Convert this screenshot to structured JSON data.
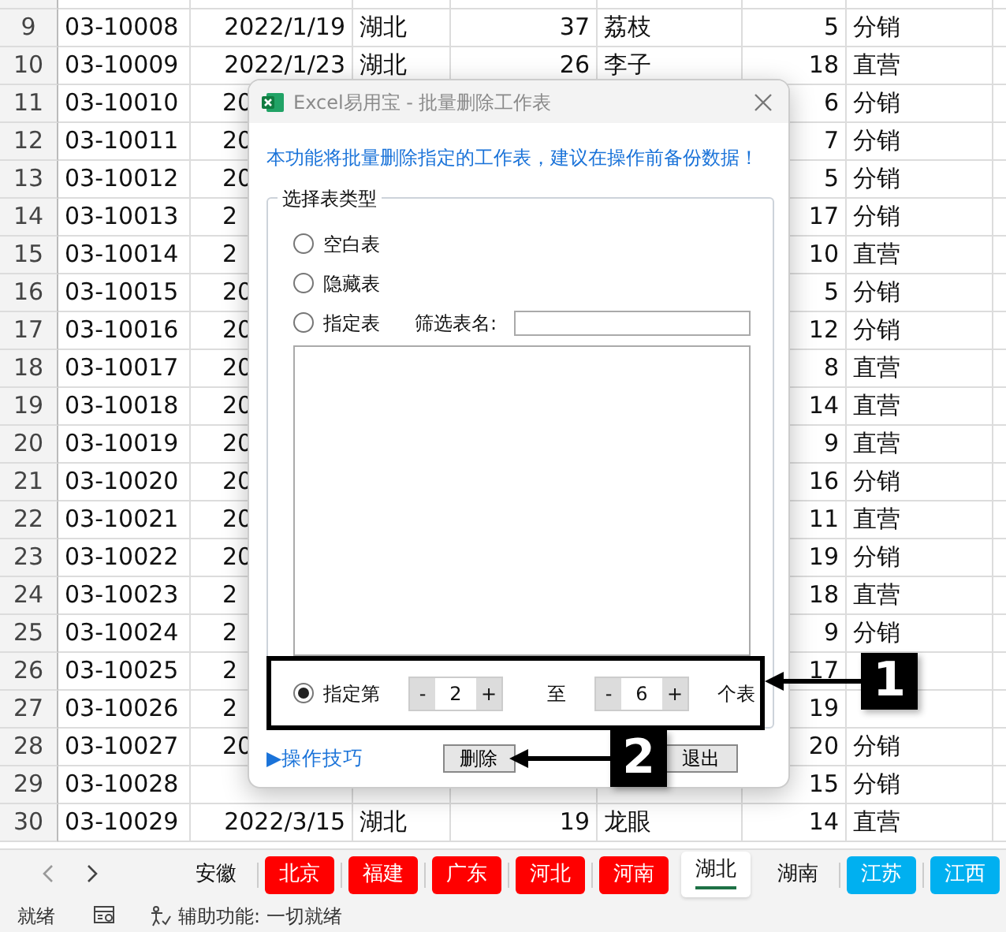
{
  "sheet": {
    "rows": [
      {
        "num": "9",
        "id": "03-10008",
        "date": "2022/1/19",
        "province": "湖北",
        "qty": "37",
        "fruit": "荔枝",
        "count": "5",
        "channel": "分销"
      },
      {
        "num": "10",
        "id": "03-10009",
        "date": "2022/1/23",
        "province": "湖北",
        "qty": "26",
        "fruit": "李子",
        "count": "18",
        "channel": "直营"
      },
      {
        "num": "11",
        "id": "03-10010",
        "date": "20",
        "count": "6",
        "channel": "分销",
        "covered": true
      },
      {
        "num": "12",
        "id": "03-10011",
        "date": "20",
        "count": "7",
        "channel": "分销",
        "covered": true
      },
      {
        "num": "13",
        "id": "03-10012",
        "date": "20",
        "count": "5",
        "channel": "分销",
        "covered": true
      },
      {
        "num": "14",
        "id": "03-10013",
        "date": "2",
        "count": "17",
        "channel": "分销",
        "covered": true
      },
      {
        "num": "15",
        "id": "03-10014",
        "date": "2",
        "count": "10",
        "channel": "直营",
        "covered": true
      },
      {
        "num": "16",
        "id": "03-10015",
        "date": "20",
        "count": "5",
        "channel": "分销",
        "covered": true
      },
      {
        "num": "17",
        "id": "03-10016",
        "date": "20",
        "count": "12",
        "channel": "分销",
        "covered": true
      },
      {
        "num": "18",
        "id": "03-10017",
        "date": "20",
        "count": "8",
        "channel": "直营",
        "covered": true
      },
      {
        "num": "19",
        "id": "03-10018",
        "date": "20",
        "count": "14",
        "channel": "直营",
        "covered": true
      },
      {
        "num": "20",
        "id": "03-10019",
        "date": "20",
        "count": "9",
        "channel": "直营",
        "covered": true
      },
      {
        "num": "21",
        "id": "03-10020",
        "date": "20",
        "count": "16",
        "channel": "分销",
        "covered": true
      },
      {
        "num": "22",
        "id": "03-10021",
        "date": "20",
        "count": "11",
        "channel": "直营",
        "covered": true
      },
      {
        "num": "23",
        "id": "03-10022",
        "date": "20",
        "count": "19",
        "channel": "分销",
        "covered": true
      },
      {
        "num": "24",
        "id": "03-10023",
        "date": "2",
        "count": "18",
        "channel": "直营",
        "covered": true
      },
      {
        "num": "25",
        "id": "03-10024",
        "date": "2",
        "count": "9",
        "channel": "分销",
        "covered": true
      },
      {
        "num": "26",
        "id": "03-10025",
        "date": "2",
        "count": "17",
        "covered": true
      },
      {
        "num": "27",
        "id": "03-10026",
        "date": "2",
        "count": "19",
        "covered": true
      },
      {
        "num": "28",
        "id": "03-10027",
        "date": "20",
        "count": "20",
        "channel": "分销",
        "covered": true
      },
      {
        "num": "29",
        "id": "03-10028",
        "count": "15",
        "channel": "分销"
      },
      {
        "num": "30",
        "id": "03-10029",
        "date": "2022/3/15",
        "province": "湖北",
        "qty": "19",
        "fruit": "龙眼",
        "count": "14",
        "channel": "直营"
      }
    ]
  },
  "dialog": {
    "title": "Excel易用宝 - 批量删除工作表",
    "notice": "本功能将批量删除指定的工作表，建议在操作前备份数据！",
    "group_title": "选择表类型",
    "options": [
      {
        "label": "空白表",
        "selected": false
      },
      {
        "label": "隐藏表",
        "selected": false
      },
      {
        "label": "指定表",
        "selected": false
      },
      {
        "label": "指定第",
        "selected": true
      }
    ],
    "filter_label": "筛选表名:",
    "spinners": [
      {
        "minus": "-",
        "value": "2",
        "plus": "+"
      },
      {
        "minus": "-",
        "value": "6",
        "plus": "+"
      }
    ],
    "to_label": "至",
    "suffix": "个表",
    "tips_link": "▶操作技巧",
    "buttons": [
      {
        "label": "删除"
      },
      {
        "label": "退出"
      }
    ]
  },
  "callouts": [
    {
      "label": "1"
    },
    {
      "label": "2"
    }
  ],
  "sheet_tabs": [
    {
      "label": "安徽",
      "selected": false
    },
    {
      "label": "北京",
      "selected": false,
      "color": "#ff0000"
    },
    {
      "label": "福建",
      "selected": false,
      "color": "#ff0000"
    },
    {
      "label": "广东",
      "selected": false,
      "color": "#ff0000"
    },
    {
      "label": "河北",
      "selected": false,
      "color": "#ff0000"
    },
    {
      "label": "河南",
      "selected": false,
      "color": "#ff0000"
    },
    {
      "label": "湖北",
      "selected": true
    },
    {
      "label": "湖南",
      "selected": false
    },
    {
      "label": "江苏",
      "selected": false,
      "color": "#00b0f0"
    },
    {
      "label": "江西",
      "selected": false,
      "color": "#00b0f0"
    }
  ],
  "status_bar": {
    "ready": "就绪",
    "accessibility": "辅助功能: 一切就绪"
  }
}
